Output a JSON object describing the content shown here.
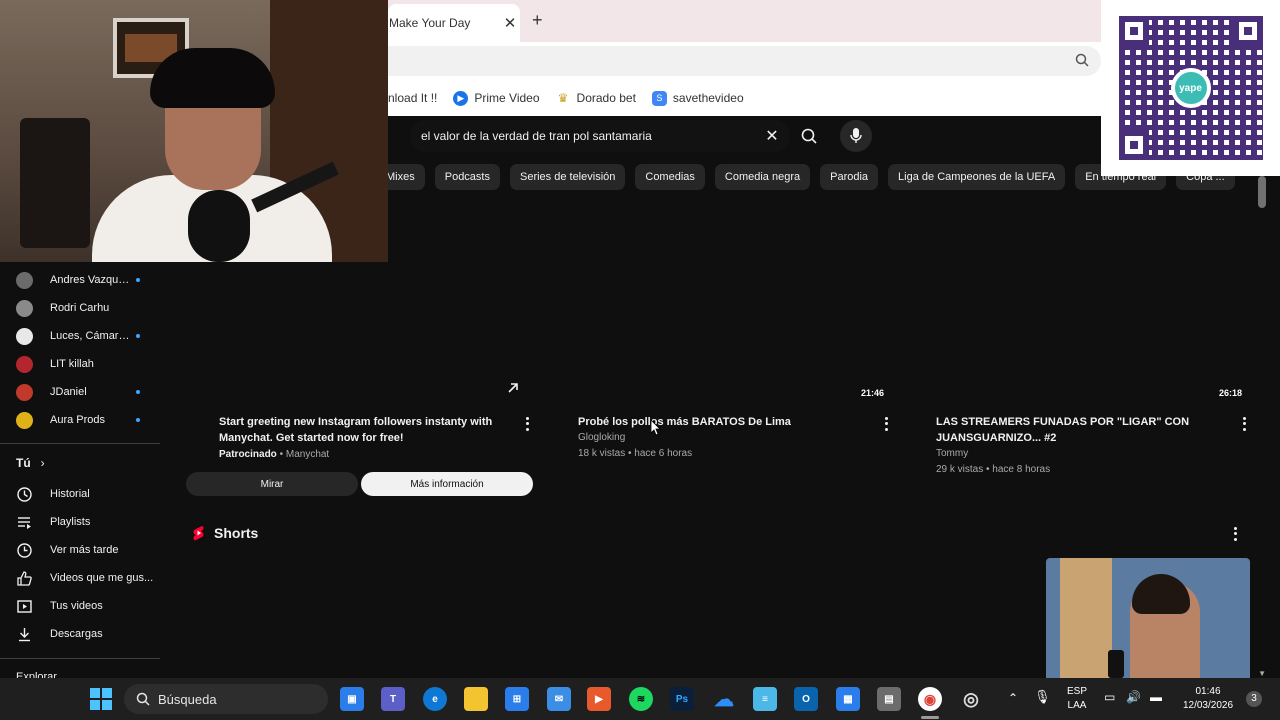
{
  "browser": {
    "tab_title": "Make Your Day",
    "tab_close": "✕",
    "new_tab": "+",
    "bookmarks": [
      {
        "label": "nload It !!",
        "icon": "bookmark-partial-icon",
        "color": ""
      },
      {
        "label": "Prime Video",
        "icon": "prime-video-icon",
        "color": "#1a73e8"
      },
      {
        "label": "Dorado bet",
        "icon": "dorado-bet-icon",
        "color": "#c9a227"
      },
      {
        "label": "savethevideo",
        "icon": "savethevideo-icon",
        "color": "#4285f4"
      }
    ]
  },
  "youtube": {
    "search_query": "el valor de la verdad de tran pol santamaria",
    "chips": [
      "Mixes",
      "Podcasts",
      "Series de televisión",
      "Comedias",
      "Comedia negra",
      "Parodia",
      "Liga de Campeones de la UEFA",
      "En tiempo real",
      "Copa ..."
    ],
    "subscriptions": [
      {
        "name": "Andres Vazquez ...",
        "new": true,
        "color": "#6b6b6b"
      },
      {
        "name": "Rodri Carhu",
        "new": false,
        "color": "#8a8a8a"
      },
      {
        "name": "Luces, Cámara, ...",
        "new": true,
        "color": "#e8e8e8"
      },
      {
        "name": "LIT killah",
        "new": false,
        "color": "#b3262d"
      },
      {
        "name": "JDaniel",
        "new": true,
        "color": "#c0392b"
      },
      {
        "name": "Aura Prods",
        "new": true,
        "color": "#e0b21a"
      }
    ],
    "you_label": "Tú",
    "you_nav": [
      {
        "label": "Historial",
        "icon": "history-icon"
      },
      {
        "label": "Playlists",
        "icon": "playlists-icon"
      },
      {
        "label": "Ver más tarde",
        "icon": "watch-later-icon"
      },
      {
        "label": "Videos que me gus...",
        "icon": "liked-videos-icon"
      },
      {
        "label": "Tus videos",
        "icon": "your-videos-icon"
      },
      {
        "label": "Descargas",
        "icon": "downloads-icon"
      }
    ],
    "explore_label": "Explorar",
    "ad": {
      "title": "Start greeting new Instagram followers instanty with Manychat. Get started now for free!",
      "sponsored": "Patrocinado",
      "advertiser": "Manychat",
      "btn_watch": "Mirar",
      "btn_more": "Más información"
    },
    "videos": [
      {
        "title": "Probé los pollos más BARATOS De Lima",
        "channel": "Glogloking",
        "meta": "18 k vistas • hace 6 horas",
        "duration": "21:46"
      },
      {
        "title": "LAS STREAMERS FUNADAS POR \"LIGAR\" CON JUANSGUARNIZO... #2",
        "channel": "Tommy",
        "meta": "29 k vistas • hace 8 horas",
        "duration": "26:18"
      }
    ],
    "shorts_label": "Shorts"
  },
  "overlay": {
    "qr_logo": "yape"
  },
  "taskbar": {
    "search_label": "Búsqueda",
    "lang_top": "ESP",
    "lang_bottom": "LAA",
    "time": "01:46",
    "date": "12/03/2026",
    "notifications": "3"
  }
}
